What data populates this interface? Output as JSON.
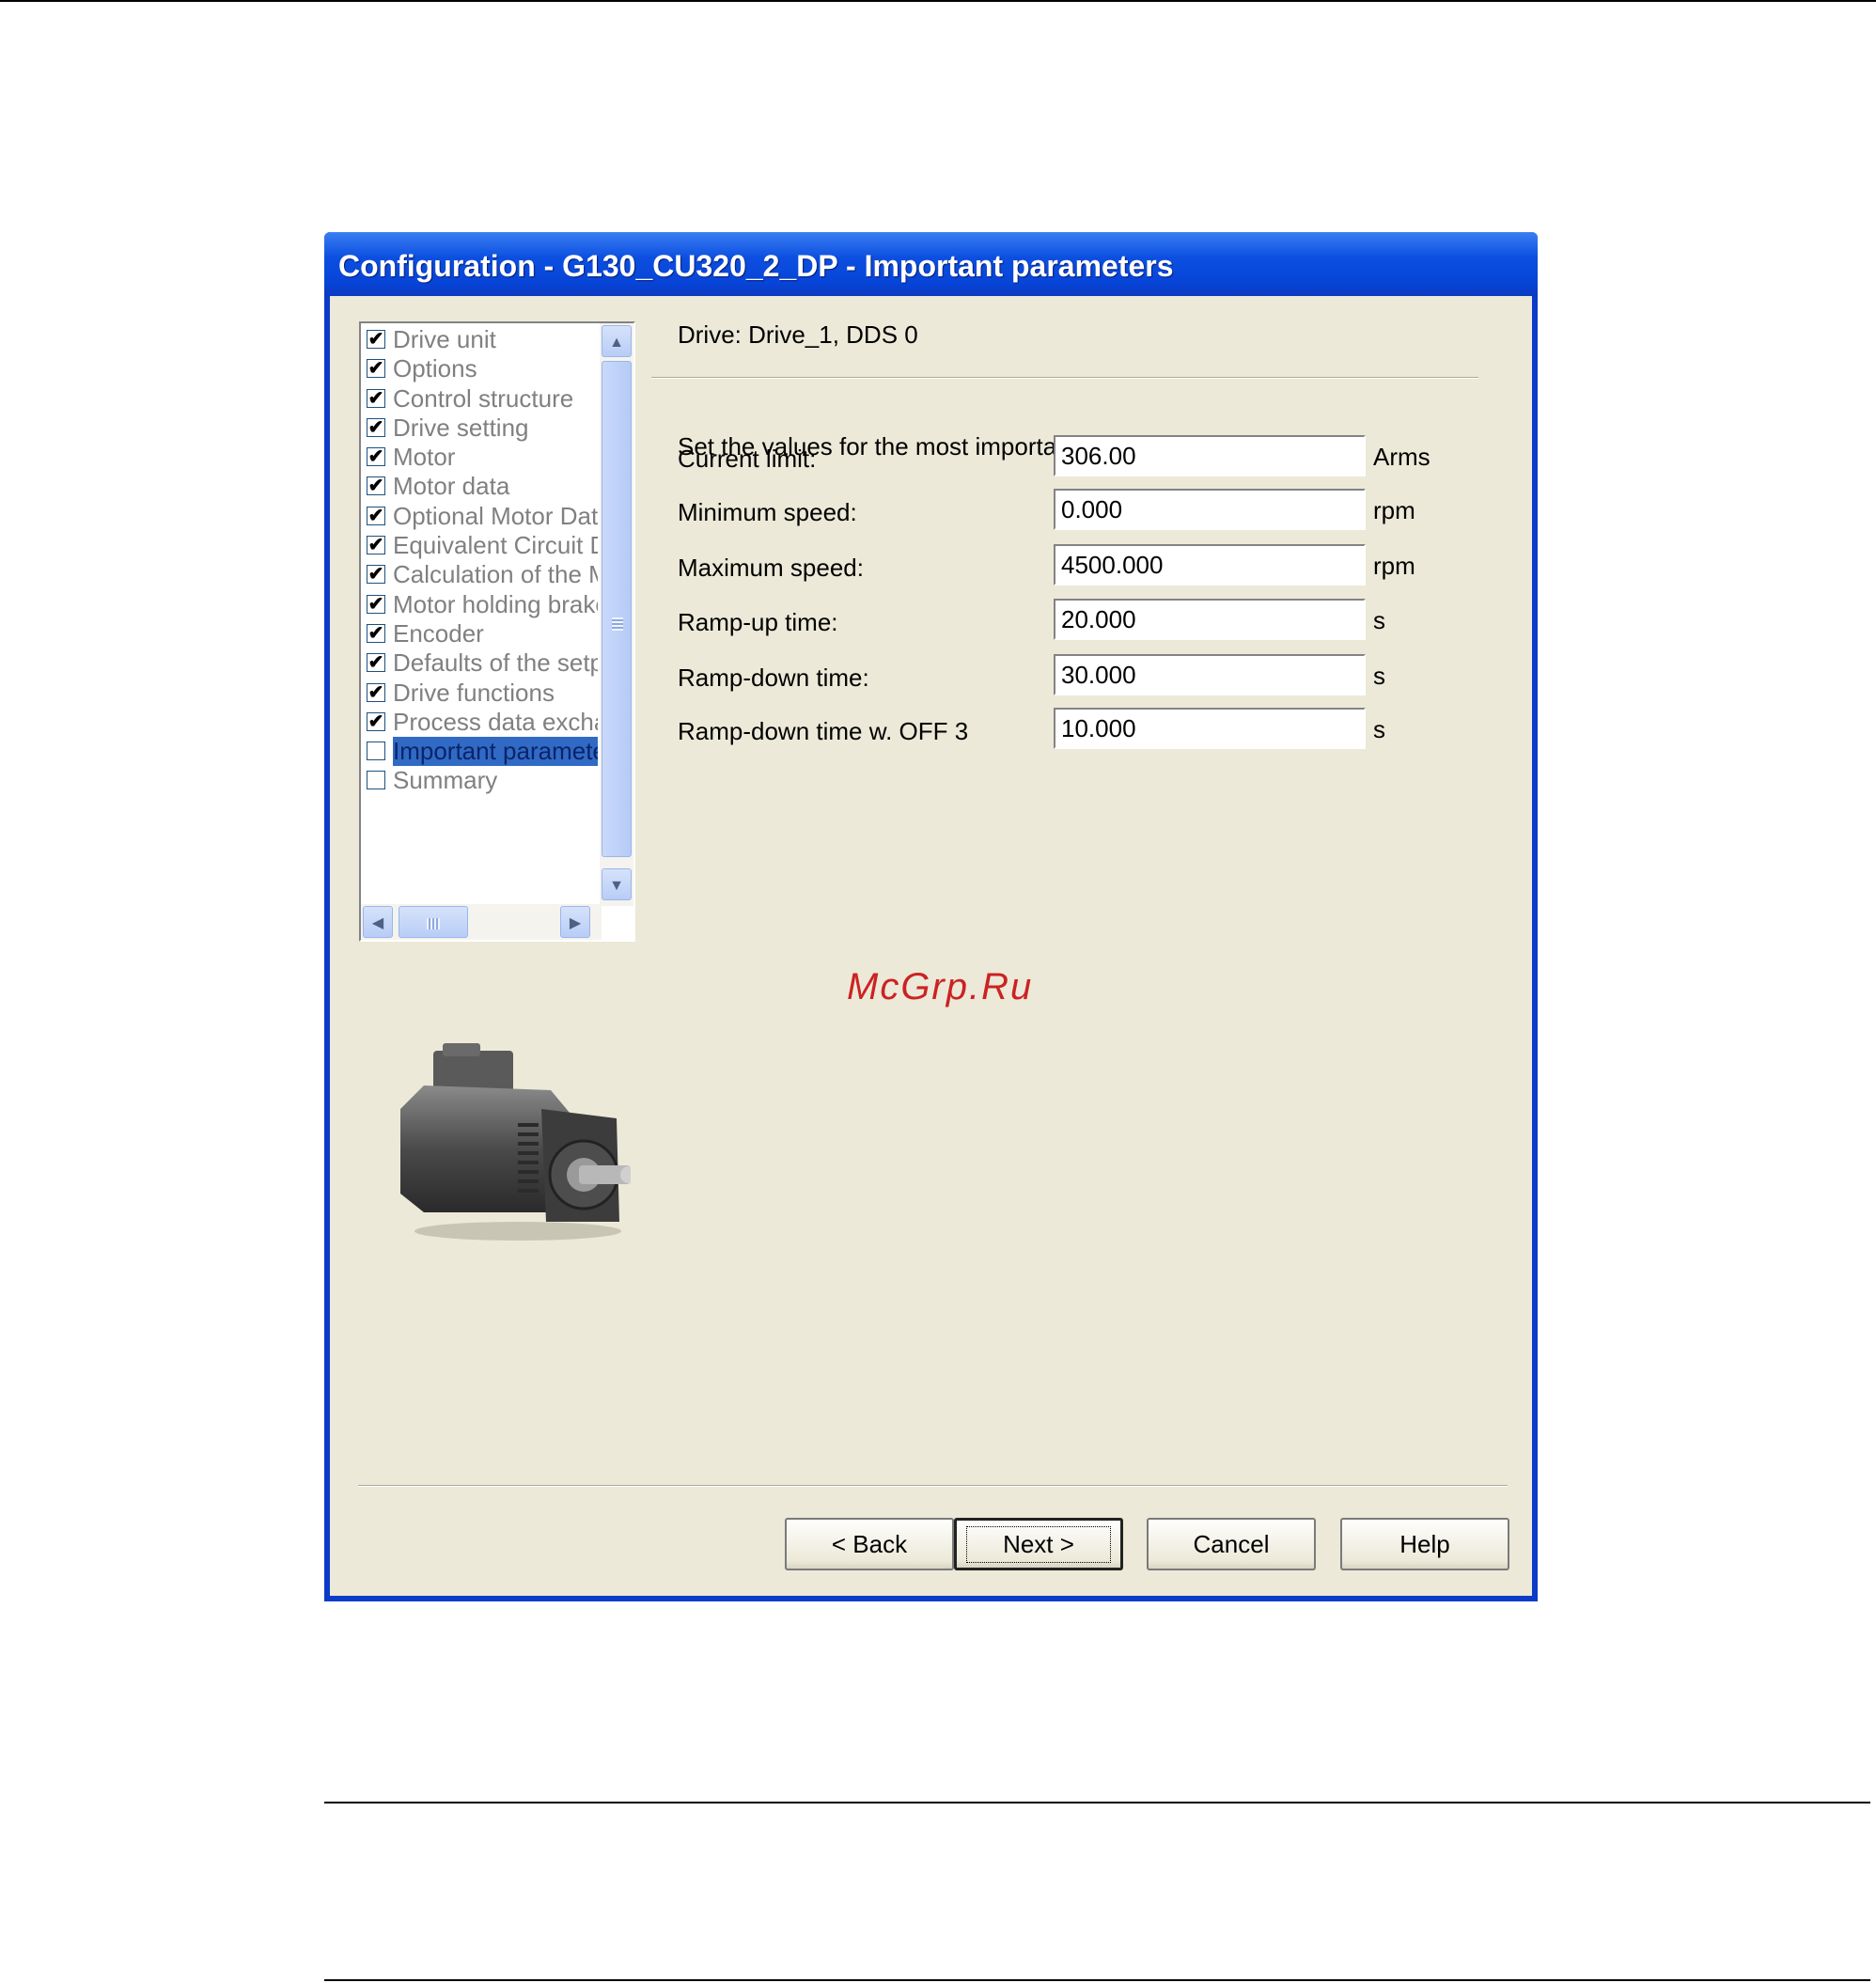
{
  "window": {
    "title": "Configuration - G130_CU320_2_DP - Important parameters"
  },
  "tree": {
    "items": [
      {
        "label": "Drive unit",
        "checked": true
      },
      {
        "label": "Options",
        "checked": true
      },
      {
        "label": "Control structure",
        "checked": true
      },
      {
        "label": "Drive setting",
        "checked": true
      },
      {
        "label": "Motor",
        "checked": true
      },
      {
        "label": "Motor data",
        "checked": true
      },
      {
        "label": "Optional Motor Dat",
        "checked": true
      },
      {
        "label": "Equivalent Circuit D",
        "checked": true
      },
      {
        "label": "Calculation of the M",
        "checked": true
      },
      {
        "label": "Motor holding brake",
        "checked": true
      },
      {
        "label": "Encoder",
        "checked": true
      },
      {
        "label": "Defaults of the setp",
        "checked": true
      },
      {
        "label": "Drive functions",
        "checked": true
      },
      {
        "label": "Process data excha",
        "checked": true
      },
      {
        "label": "Important paramete",
        "checked": false,
        "selected": true
      },
      {
        "label": "Summary",
        "checked": false
      }
    ],
    "scroll_up": "▲",
    "scroll_down": "▼",
    "scroll_left": "◀",
    "scroll_right": "▶"
  },
  "main": {
    "drive_label": "Drive: Drive_1, DDS 0",
    "instruction": "Set the values for the most important parameters:",
    "params": [
      {
        "label": "Current limit:",
        "value": "306.00",
        "unit": "Arms"
      },
      {
        "label": "Minimum speed:",
        "value": "0.000",
        "unit": "rpm"
      },
      {
        "label": "Maximum speed:",
        "value": "4500.000",
        "unit": "rpm"
      },
      {
        "label": "Ramp-up time:",
        "value": "20.000",
        "unit": "s"
      },
      {
        "label": "Ramp-down time:",
        "value": "30.000",
        "unit": "s"
      },
      {
        "label": "Ramp-down time w. OFF 3",
        "value": "10.000",
        "unit": "s"
      }
    ]
  },
  "watermark": "McGrp.Ru",
  "buttons": {
    "back": "< Back",
    "next": "Next >",
    "cancel": "Cancel",
    "help": "Help"
  }
}
